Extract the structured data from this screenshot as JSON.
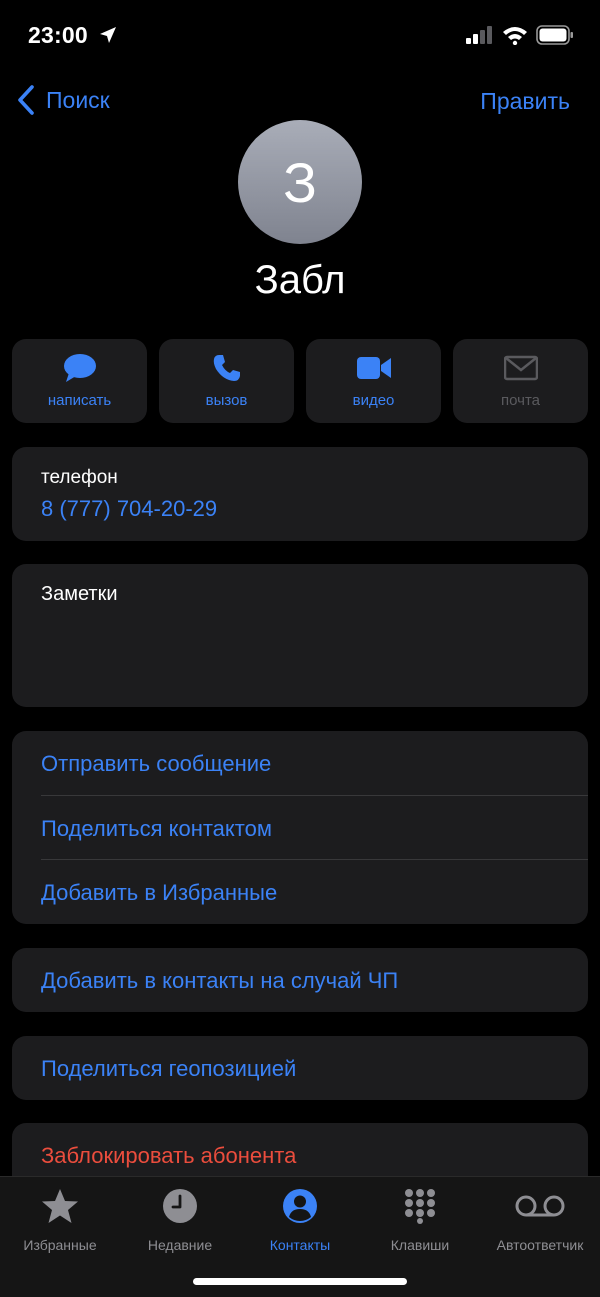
{
  "status_bar": {
    "time": "23:00",
    "icons": [
      "location-arrow-icon",
      "signal-icon",
      "wifi-icon",
      "battery-icon"
    ]
  },
  "nav": {
    "back_label": "Поиск",
    "edit_label": "Править"
  },
  "contact": {
    "avatar_initial": "З",
    "name": "Забл"
  },
  "actions": [
    {
      "label": "написать",
      "icon": "message-bubble-icon",
      "enabled": true
    },
    {
      "label": "вызов",
      "icon": "phone-icon",
      "enabled": true
    },
    {
      "label": "видео",
      "icon": "video-camera-icon",
      "enabled": true
    },
    {
      "label": "почта",
      "icon": "mail-envelope-icon",
      "enabled": false
    }
  ],
  "phone": {
    "label": "телефон",
    "value": "8 (777) 704-20-29"
  },
  "notes": {
    "label": "Заметки"
  },
  "menu": [
    {
      "label": "Отправить сообщение"
    },
    {
      "label": "Поделиться контактом"
    },
    {
      "label": "Добавить в Избранные"
    }
  ],
  "emergency": {
    "label": "Добавить в контакты на случай ЧП"
  },
  "location": {
    "label": "Поделиться геопозицией"
  },
  "block": {
    "label": "Заблокировать абонента"
  },
  "tabs": [
    {
      "label": "Избранные",
      "icon": "star-icon",
      "active": false
    },
    {
      "label": "Недавние",
      "icon": "clock-icon",
      "active": false
    },
    {
      "label": "Контакты",
      "icon": "person-circle-icon",
      "active": true
    },
    {
      "label": "Клавиши",
      "icon": "keypad-icon",
      "active": false
    },
    {
      "label": "Автоответчик",
      "icon": "voicemail-icon",
      "active": false
    }
  ],
  "colors": {
    "accent": "#3b82f6",
    "destructive": "#eb4d3d",
    "card": "#1c1c1e",
    "background": "#000000"
  }
}
